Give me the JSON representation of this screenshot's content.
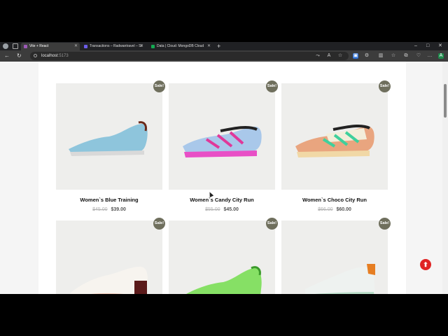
{
  "browser": {
    "tabs": [
      {
        "title": "Vite + React",
        "active": true,
        "favicon_color": "#9b59b6"
      },
      {
        "title": "Transactions – Radwantravel – St",
        "active": false,
        "favicon_color": "#6c5ce7"
      },
      {
        "title": "Data | Cloud: MongoDB Cloud",
        "active": false,
        "favicon_color": "#13aa52"
      }
    ],
    "new_tab_icon": "+",
    "url_host": "localhost",
    "url_port": ":5173",
    "window_controls": [
      "–",
      "□",
      "✕"
    ]
  },
  "products": [
    {
      "name": "Women`s Blue Training",
      "old_price": "$45.00",
      "price": "$39.00",
      "badge": "Sale!",
      "shoe_color": "#8ec5dc",
      "accent": "#6b2a1a"
    },
    {
      "name": "Women`s Candy City Run",
      "old_price": "$55.00",
      "price": "$45.00",
      "badge": "Sale!",
      "shoe_color": "#a9c8ea",
      "accent": "#e0389a"
    },
    {
      "name": "Women`s Choco City Run",
      "old_price": "$66.00",
      "price": "$60.00",
      "badge": "Sale!",
      "shoe_color": "#e9a57f",
      "accent": "#3fd09c"
    },
    {
      "name": "",
      "old_price": "",
      "price": "",
      "badge": "Sale!",
      "shoe_color": "#f2ded4",
      "accent": "#5a1a1a"
    },
    {
      "name": "",
      "old_price": "",
      "price": "",
      "badge": "Sale!",
      "shoe_color": "#86e065",
      "accent": "#3a9a2a"
    },
    {
      "name": "",
      "old_price": "",
      "price": "",
      "badge": "Sale!",
      "shoe_color": "#b9ddc8",
      "accent": "#e67e22"
    }
  ],
  "scroll_top_icon": "⬆"
}
